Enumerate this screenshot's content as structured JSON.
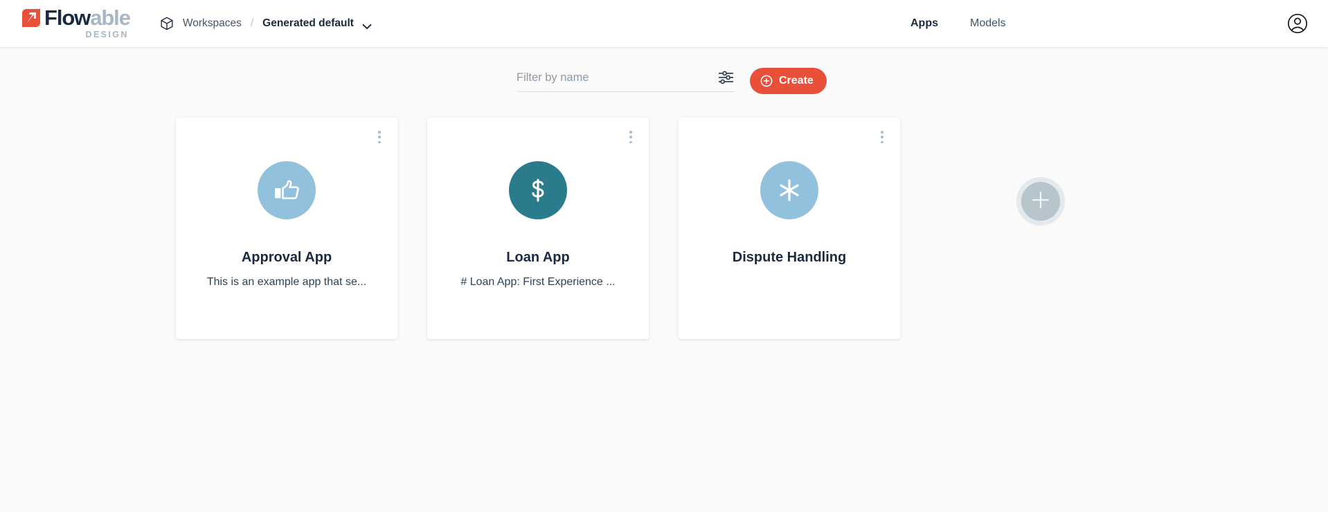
{
  "header": {
    "logo": {
      "mark": "flowable-arrow-logo",
      "word_dark": "Flow",
      "word_light": "able",
      "subtitle": "DESIGN"
    },
    "breadcrumb": {
      "icon": "cube-icon",
      "root_label": "Workspaces",
      "separator": "/",
      "current_label": "Generated default",
      "chevron": "chevron-down-icon"
    },
    "nav": [
      {
        "label": "Apps",
        "active": true
      },
      {
        "label": "Models",
        "active": false
      }
    ],
    "account_icon": "user-circle-icon"
  },
  "toolbar": {
    "filter_placeholder": "Filter by name",
    "filter_value": "",
    "filter_icon": "sliders-filter-icon",
    "create_label": "Create",
    "create_icon": "plus-circle-icon"
  },
  "apps": [
    {
      "title": "Approval App",
      "description": "This is an example app that se...",
      "icon": "thumbs-up-icon",
      "avatar_color": "#92c1dd",
      "menu_icon": "kebab-menu-icon"
    },
    {
      "title": "Loan App",
      "description": "# Loan App: First Experience ...",
      "icon": "dollar-sign-icon",
      "avatar_color": "#2a7b8c",
      "menu_icon": "kebab-menu-icon"
    },
    {
      "title": "Dispute Handling",
      "description": "",
      "icon": "asterisk-icon",
      "avatar_color": "#92c1dd",
      "menu_icon": "kebab-menu-icon"
    }
  ],
  "add_app": {
    "icon": "plus-icon",
    "label": ""
  },
  "colors": {
    "accent_red": "#e8503a",
    "logo_dark": "#1b2a41",
    "logo_light": "#a9b6c3",
    "page_bg": "#fafafa",
    "card_bg": "#ffffff",
    "avatar_blue": "#92c1dd",
    "avatar_teal": "#2a7b8c",
    "add_button": "#b6c4cc"
  }
}
